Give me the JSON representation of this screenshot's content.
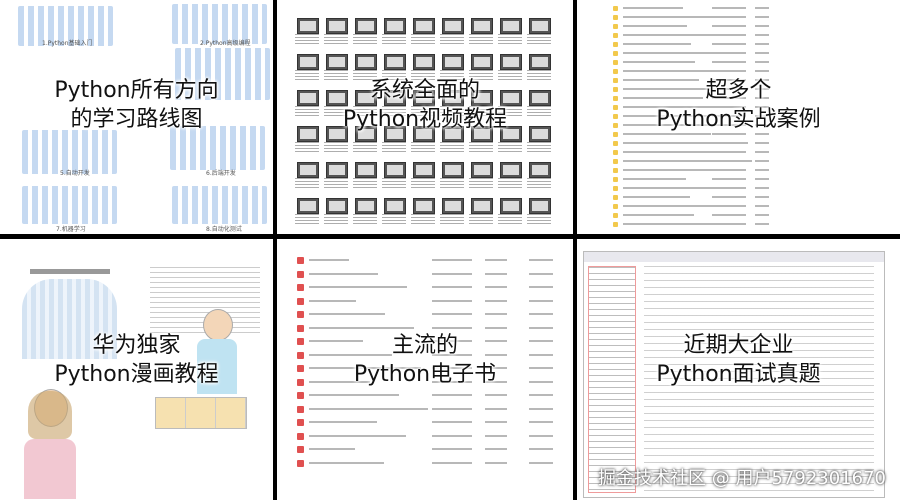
{
  "panels": [
    {
      "caption_line1": "Python所有方向",
      "caption_line2": "的学习路线图"
    },
    {
      "caption_line1": "系统全面的",
      "caption_line2": "Python视频教程"
    },
    {
      "caption_line1": "超多个",
      "caption_line2": "Python实战案例"
    },
    {
      "caption_line1": "华为独家",
      "caption_line2": "Python漫画教程"
    },
    {
      "caption_line1": "主流的",
      "caption_line2": "Python电子书"
    },
    {
      "caption_line1": "近期大企业",
      "caption_line2": "Python面试真题"
    }
  ],
  "roadmap_labels": [
    "1.Python基础入门",
    "2.Python高级编程",
    "5.自动开发",
    "6.后端开发",
    "7.机器学习",
    "8.自动化测试"
  ],
  "watermark": "掘金技术社区 @ 用户5792301670"
}
